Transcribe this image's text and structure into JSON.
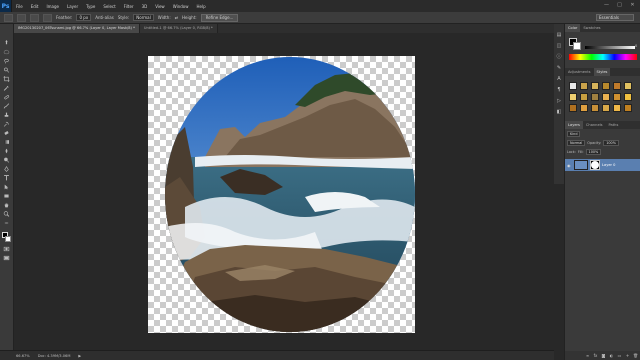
{
  "app": {
    "logo": "Ps",
    "menu": [
      "File",
      "Edit",
      "Image",
      "Layer",
      "Type",
      "Select",
      "Filter",
      "3D",
      "View",
      "Window",
      "Help"
    ],
    "window_controls": [
      "—",
      "□",
      "✕"
    ]
  },
  "options_bar": {
    "feather_label": "Feather:",
    "feather_value": "0 px",
    "anti_alias_label": "Anti-alias",
    "style_label": "Style:",
    "style_value": "Normal",
    "width_label": "Width:",
    "height_label": "Height:",
    "refine_edge_label": "Refine Edge...",
    "workspace": "Essentials"
  },
  "tabs": [
    {
      "label": "IMG20130207_06Tsunami.jpg @ 66.7% (Layer 0, Layer Mask/8) *",
      "active": true
    },
    {
      "label": "Untitled-1 @ 66.7% (Layer 0, RGB/8) *",
      "active": false
    }
  ],
  "status": {
    "zoom": "66.67%",
    "doc_size": "Doc: 4.39M/3.06M"
  },
  "color_panel": {
    "tabs": [
      "Color",
      "Swatches"
    ],
    "value": "0",
    "fg": "#000000",
    "bg": "#ffffff"
  },
  "adjust_panel": {
    "tabs": [
      "Adjustments",
      "Styles"
    ],
    "swatches": [
      "#e8e8e8",
      "#c9a24a",
      "#d6b35a",
      "#b8892c",
      "#c07a2a",
      "#e0c060",
      "#f0d070",
      "#c8a040",
      "#a08040",
      "#e8b050",
      "#d09030",
      "#f0c040",
      "#b07020",
      "#e0a040",
      "#c89038",
      "#d8a848",
      "#f0b848",
      "#c08020"
    ]
  },
  "layers_panel": {
    "tabs": [
      "Layers",
      "Channels",
      "Paths"
    ],
    "kind_label": "Kind",
    "blend_mode": "Normal",
    "opacity_label": "Opacity:",
    "opacity_value": "100%",
    "lock_label": "Lock:",
    "fill_label": "Fill:",
    "fill_value": "100%",
    "layer_name": "Layer 0"
  }
}
